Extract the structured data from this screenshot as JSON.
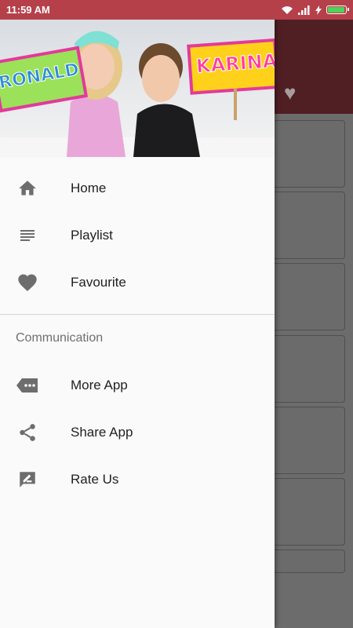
{
  "status": {
    "time": "11:59 AM",
    "battery_level": 0.95,
    "colors": {
      "bar": "#b5404a",
      "battery": "#4cd35a"
    }
  },
  "header": {
    "sign_left": "RONALD",
    "sign_right": "KARINA"
  },
  "menu": {
    "home": "Home",
    "playlist": "Playlist",
    "favourite": "Favourite"
  },
  "communication": {
    "title": "Communication",
    "more_app": "More App",
    "share_app": "Share App",
    "rate_us": "Rate Us"
  },
  "icons": [
    "home-icon",
    "playlist-icon",
    "heart-icon",
    "more-icon",
    "share-icon",
    "rate-icon",
    "wifi-icon",
    "signal-icon",
    "battery-icon"
  ]
}
